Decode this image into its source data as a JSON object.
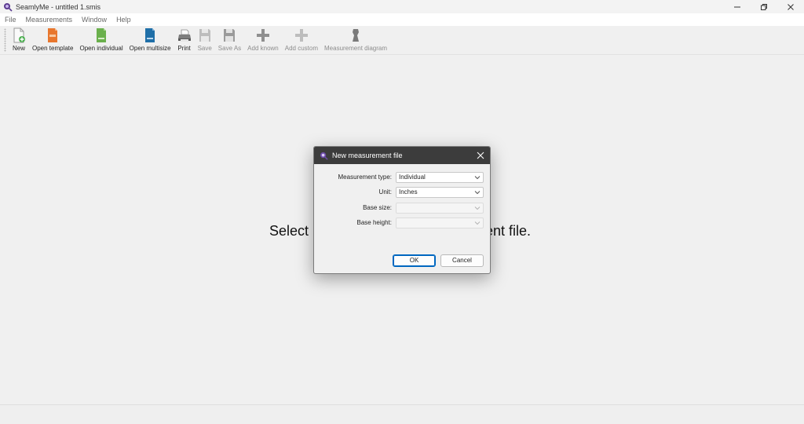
{
  "window": {
    "title": "SeamlyMe - untitled 1.smis"
  },
  "menu": [
    "File",
    "Measurements",
    "Window",
    "Help"
  ],
  "toolbar": {
    "new": "New",
    "open_template": "Open template",
    "open_individual": "Open individual",
    "open_multisize": "Open multisize",
    "print": "Print",
    "save": "Save",
    "save_as": "Save As",
    "add_known": "Add known",
    "add_custom": "Add custom",
    "measurement_diagram": "Measurement diagram"
  },
  "workspace": {
    "message_head": "Select",
    "message_tail": "ent file."
  },
  "dialog": {
    "title": "New measurement file",
    "fields": {
      "measurement_type": {
        "label": "Measurement type:",
        "value": "Individual"
      },
      "unit": {
        "label": "Unit:",
        "value": "Inches"
      },
      "base_size": {
        "label": "Base size:",
        "value": ""
      },
      "base_height": {
        "label": "Base height:",
        "value": ""
      }
    },
    "ok_label": "OK",
    "cancel_label": "Cancel"
  },
  "colors": {
    "dialog_title_bg": "#3c3c3c",
    "primary_button_border": "#0067c0",
    "app_icon": "#5b3b8f",
    "icon_orange": "#e8772e",
    "icon_green": "#6ab04c",
    "icon_blue": "#1f6fa8"
  }
}
